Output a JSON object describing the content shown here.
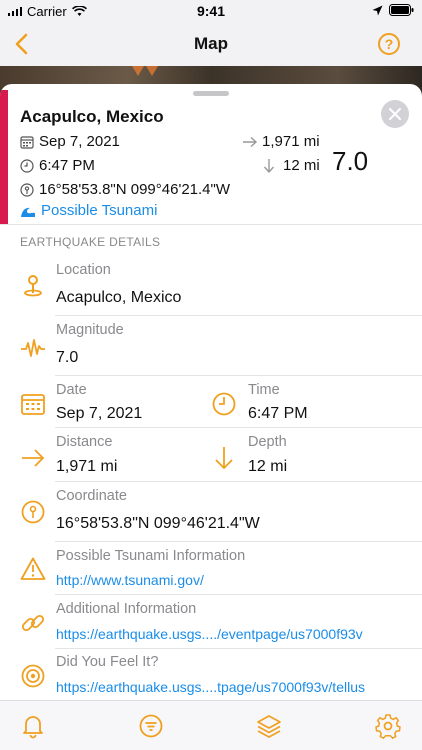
{
  "status": {
    "carrier": "Carrier",
    "time": "9:41"
  },
  "nav": {
    "title": "Map",
    "help": "?"
  },
  "header": {
    "place": "Acapulco, Mexico",
    "date": "Sep 7, 2021",
    "time": "6:47 PM",
    "coordinate": "16°58'53.8\"N 099°46'21.4\"W",
    "distance": "1,971 mi",
    "depth": "12 mi",
    "magnitude": "7.0",
    "tsunami": "Possible Tsunami"
  },
  "section_title": "EARTHQUAKE DETAILS",
  "details": {
    "location": {
      "label": "Location",
      "value": "Acapulco, Mexico"
    },
    "magnitude": {
      "label": "Magnitude",
      "value": "7.0"
    },
    "date": {
      "label": "Date",
      "value": "Sep 7, 2021"
    },
    "time": {
      "label": "Time",
      "value": "6:47 PM"
    },
    "distance": {
      "label": "Distance",
      "value": "1,971 mi"
    },
    "depth": {
      "label": "Depth",
      "value": "12 mi"
    },
    "coordinate": {
      "label": "Coordinate",
      "value": "16°58'53.8\"N 099°46'21.4\"W"
    },
    "tsunami_info": {
      "label": "Possible Tsunami Information",
      "value": "http://www.tsunami.gov/"
    },
    "additional": {
      "label": "Additional Information",
      "value": "https://earthquake.usgs..../eventpage/us7000f93v"
    },
    "feel": {
      "label": "Did You Feel It?",
      "value": "https://earthquake.usgs....tpage/us7000f93v/tellus"
    }
  },
  "colors": {
    "accent": "#f0a020",
    "link": "#1a8de8",
    "magnitude_bar": "#d81b4e"
  },
  "tabs": [
    "bell-icon",
    "filter-icon",
    "layers-icon",
    "gear-icon"
  ]
}
